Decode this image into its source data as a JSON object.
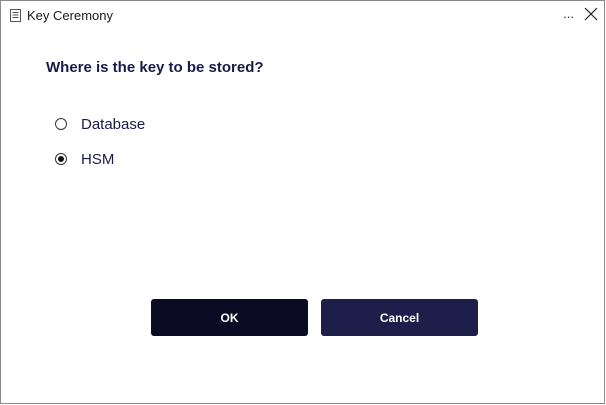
{
  "window": {
    "title": "Key Ceremony",
    "more_label": "...",
    "title_icon": "document-icon",
    "close_icon": "close-icon"
  },
  "dialog": {
    "question": "Where is the key to be stored?",
    "options": [
      {
        "label": "Database",
        "selected": false
      },
      {
        "label": "HSM",
        "selected": true
      }
    ]
  },
  "buttons": {
    "ok_label": "OK",
    "cancel_label": "Cancel"
  },
  "colors": {
    "text": "#1a1a4a",
    "ok_bg": "#0b0b24",
    "cancel_bg": "#1e1e4a"
  }
}
